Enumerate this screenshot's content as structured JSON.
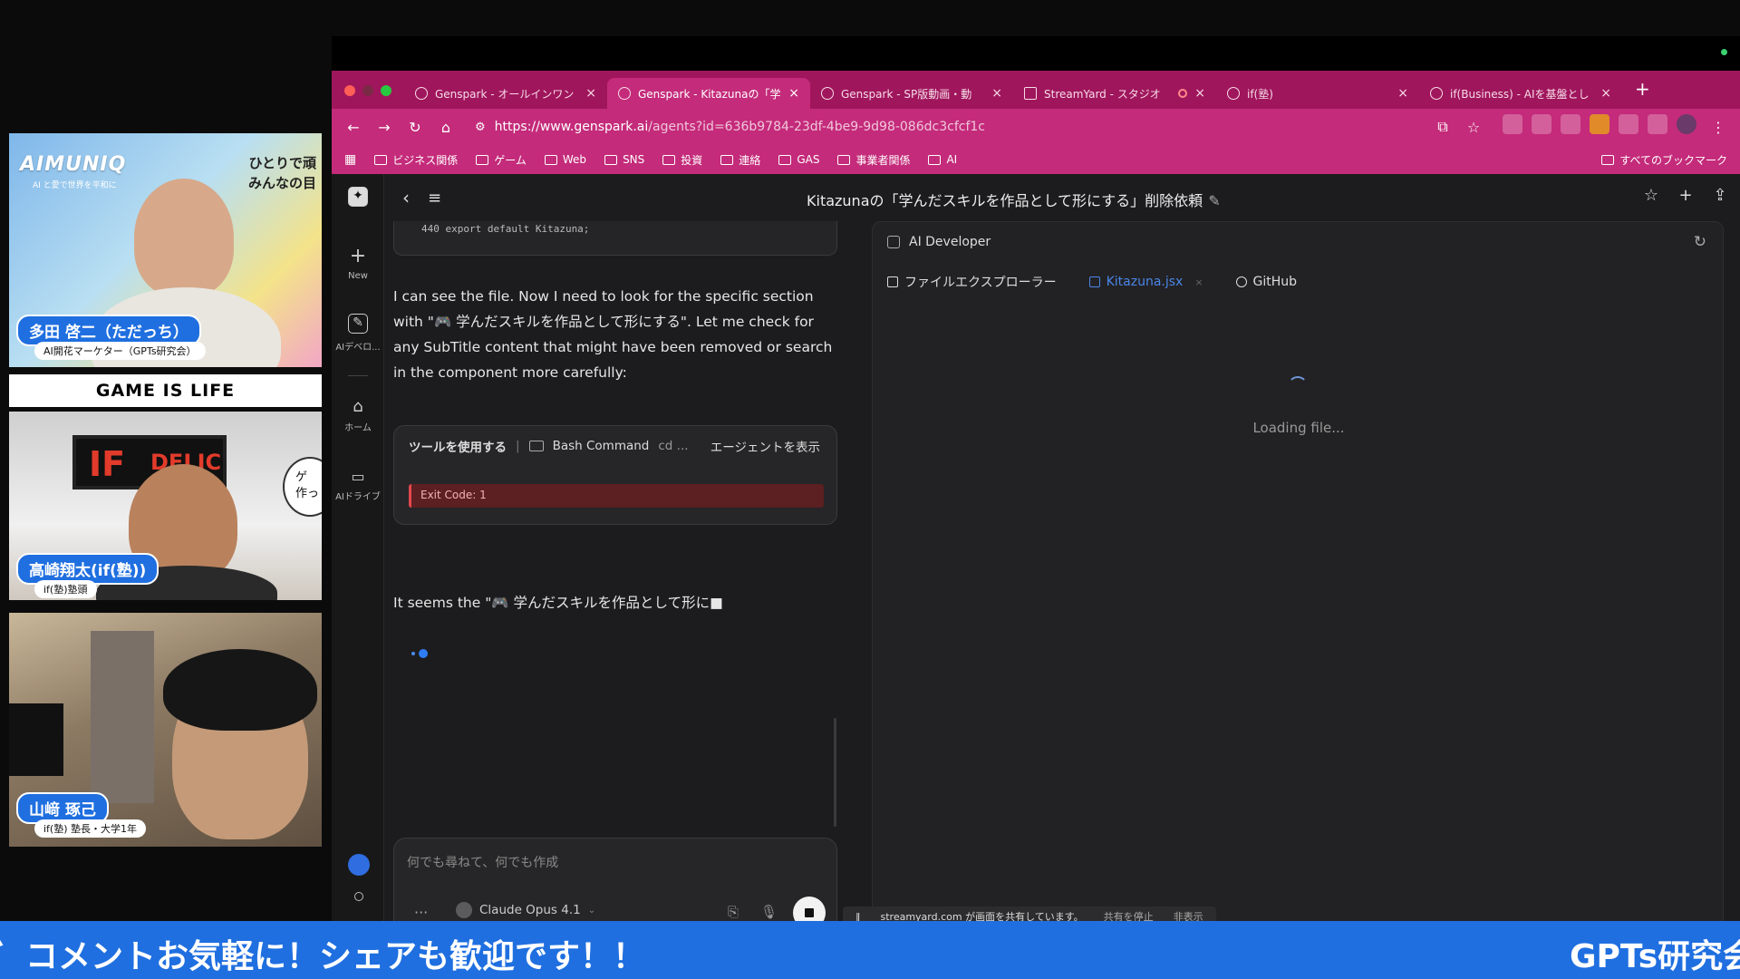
{
  "webcams": {
    "cam1": {
      "logo": "AIMUNIQ",
      "logo_sub": "AI と愛で世界を平和に",
      "tag_line1": "ひとりで頑",
      "tag_line2": "みんなの目",
      "name": "多田 啓二（ただっち）",
      "role": "AI開花マーケター（GPTs研究会）"
    },
    "banner": "GAME IS LIFE",
    "cam2": {
      "sign1": "IF",
      "sign2": "DELIC",
      "bubble_line1": "ゲ",
      "bubble_line2": "作っ",
      "name": "高崎翔太(if(塾))",
      "role": "if(塾)塾頭"
    },
    "cam3": {
      "name": "山﨑 琢己",
      "role": "if(塾) 塾長・大学1年"
    }
  },
  "browser": {
    "tabs": [
      {
        "label": "Genspark - オールインワン",
        "active": false
      },
      {
        "label": "Genspark - Kitazunaの「学",
        "active": true
      },
      {
        "label": "Genspark - SP版動画・動",
        "active": false
      },
      {
        "label": "StreamYard - スタジオ",
        "active": false
      },
      {
        "label": "if(塾)",
        "active": false
      },
      {
        "label": "if(Business) - AIを基盤とし",
        "active": false
      }
    ],
    "url_host": "https://www.genspark.ai",
    "url_rest": "/agents?id=636b9784-23df-4be9-9d98-086dc3cfcf1c",
    "bookmarks": [
      "ビジネス関係",
      "ゲーム",
      "Web",
      "SNS",
      "投資",
      "連絡",
      "GAS",
      "事業者関係",
      "AI"
    ],
    "bookmarks_all": "すべてのブックマーク"
  },
  "app": {
    "rail": {
      "new": "New",
      "ai_dev": "AIデベロ...",
      "home": "ホーム",
      "drive": "AIドライブ"
    },
    "title": "Kitazunaの「学んだスキルを作品として形にする」削除依頼",
    "code_line": "440    export default Kitazuna;",
    "msg1": "I can see the file. Now I need to look for the specific section with \"🎮 学んだスキルを作品として形にする\". Let me check for any SubTitle content that might have been removed or search in the component more carefully:",
    "tool": {
      "label": "ツールを使用する",
      "sep": "|",
      "cmd": "Bash Command",
      "cmd_arg": "cd ...",
      "show": "エージェントを表示",
      "exit": "Exit Code: 1"
    },
    "msg2": "It seems the \"🎮 学んだスキルを作品として形に■",
    "composer": {
      "placeholder": "何でも尋ねて、何でも作成",
      "model": "Claude Opus 4.1"
    },
    "panel": {
      "title": "AI Developer",
      "tabs": [
        {
          "label": "ファイルエクスプローラー",
          "active": false
        },
        {
          "label": "Kitazuna.jsx",
          "active": true
        },
        {
          "label": "GitHub",
          "active": false
        }
      ],
      "loading": "Loading file..."
    },
    "share": {
      "text": "streamyard.com が画面を共有しています。",
      "stop": "共有を停止",
      "hide": "非表示"
    }
  },
  "ticker": {
    "message": "゛コメントお気軽に！シェアも歓迎です！！",
    "right": "GPTs研究会"
  },
  "colors": {
    "tab_bar": "#a0165c",
    "toolbar": "#c42b7a",
    "ticker": "#1f6fe0",
    "accent_blue": "#4a86e8"
  }
}
